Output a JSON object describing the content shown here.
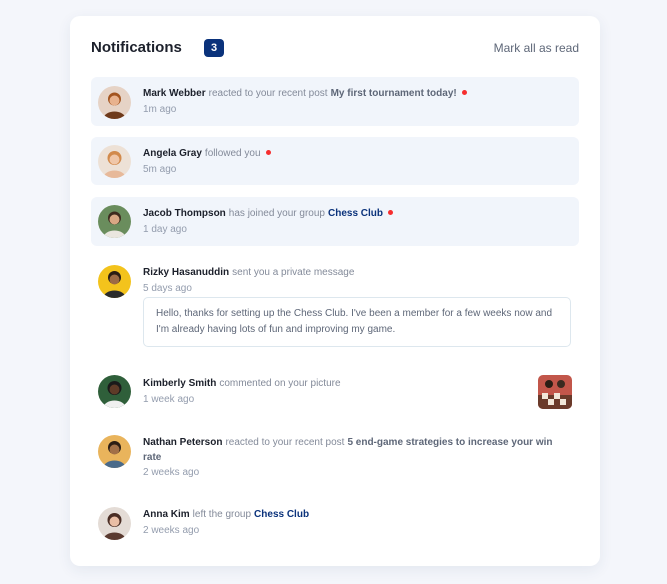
{
  "header": {
    "title": "Notifications",
    "unread_count": "3",
    "mark_all": "Mark all as read"
  },
  "notifications": [
    {
      "name": "Mark Webber",
      "action": "reacted to your recent post",
      "target": "My first tournament today!",
      "time": "1m ago",
      "unread": true,
      "avatar_icon": "avatar-mark-webber"
    },
    {
      "name": "Angela Gray",
      "action": "followed you",
      "time": "5m ago",
      "unread": true,
      "avatar_icon": "avatar-angela-gray"
    },
    {
      "name": "Jacob Thompson",
      "action": "has joined your group",
      "group": "Chess Club",
      "time": "1 day ago",
      "unread": true,
      "avatar_icon": "avatar-jacob-thompson"
    },
    {
      "name": "Rizky Hasanuddin",
      "action": "sent you a private message",
      "time": "5 days ago",
      "unread": false,
      "message": "Hello, thanks for setting up the Chess Club. I've been a member for a few weeks now and I'm already having lots of fun and improving my game.",
      "avatar_icon": "avatar-rizky-hasanuddin"
    },
    {
      "name": "Kimberly Smith",
      "action": "commented on your picture",
      "time": "1 week ago",
      "unread": false,
      "avatar_icon": "avatar-kimberly-smith",
      "picture_icon": "chess-picture-thumbnail"
    },
    {
      "name": "Nathan Peterson",
      "action": "reacted to your recent post",
      "target": "5 end-game strategies to increase your win rate",
      "time": "2 weeks ago",
      "unread": false,
      "avatar_icon": "avatar-nathan-peterson"
    },
    {
      "name": "Anna Kim",
      "action": "left the group",
      "group": "Chess Club",
      "time": "2 weeks ago",
      "unread": false,
      "avatar_icon": "avatar-anna-kim"
    }
  ],
  "colors": {
    "unread_bg": "#f1f5fb",
    "badge": "#0a327b",
    "dot": "#f62d2e",
    "group_link": "#0a327b"
  }
}
